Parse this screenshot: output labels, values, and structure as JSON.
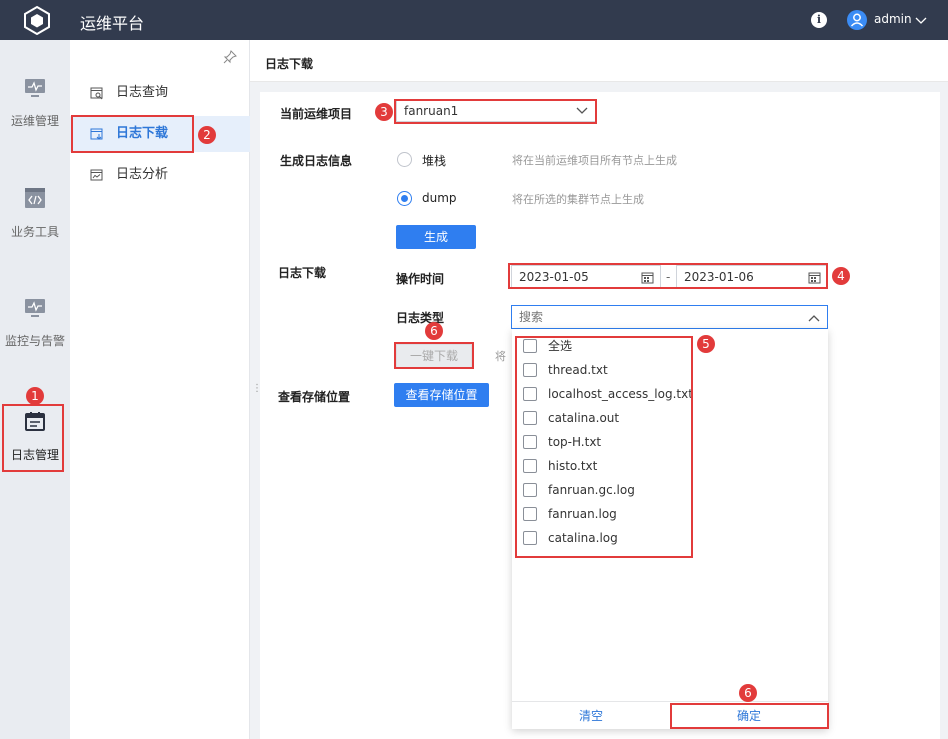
{
  "app": {
    "title": "运维平台",
    "user": "admin",
    "info_icon": "i"
  },
  "rail": [
    {
      "label": "运维管理",
      "icon": "monitor-icon"
    },
    {
      "label": "业务工具",
      "icon": "code-window-icon"
    },
    {
      "label": "监控与告警",
      "icon": "alarm-monitor-icon"
    },
    {
      "label": "日志管理",
      "icon": "log-calendar-icon",
      "active": true
    }
  ],
  "subnav": [
    {
      "label": "日志查询",
      "icon": "log-search-icon"
    },
    {
      "label": "日志下载",
      "icon": "log-download-icon",
      "active": true
    },
    {
      "label": "日志分析",
      "icon": "log-analysis-icon"
    }
  ],
  "page": {
    "title": "日志下载"
  },
  "form": {
    "project_label": "当前运维项目",
    "project_value": "fanruan1",
    "gen_label": "生成日志信息",
    "radio_stack": "堆栈",
    "radio_stack_desc": "将在当前运维项目所有节点上生成",
    "radio_dump": "dump",
    "radio_dump_desc": "将在所选的集群节点上生成",
    "gen_button": "生成",
    "download_label": "日志下载",
    "time_label": "操作时间",
    "date_start": "2023-01-05",
    "date_sep": "-",
    "date_end": "2023-01-06",
    "type_label": "日志类型",
    "type_placeholder": "搜索",
    "one_click_download": "一键下载",
    "download_hint_partial": "将",
    "storage_label": "查看存储位置",
    "storage_button": "查看存储位置"
  },
  "dropdown": {
    "options": [
      "全选",
      "thread.txt",
      "localhost_access_log.txt",
      "catalina.out",
      "top-H.txt",
      "histo.txt",
      "fanruan.gc.log",
      "fanruan.log",
      "catalina.log"
    ],
    "clear": "清空",
    "confirm": "确定"
  },
  "badges": {
    "b1": "1",
    "b2": "2",
    "b3": "3",
    "b4": "4",
    "b5": "5",
    "b6a": "6",
    "b6b": "6"
  },
  "colors": {
    "topbar": "#323b4e",
    "accent": "#2f7ef0",
    "annotation": "#e23b3b"
  }
}
